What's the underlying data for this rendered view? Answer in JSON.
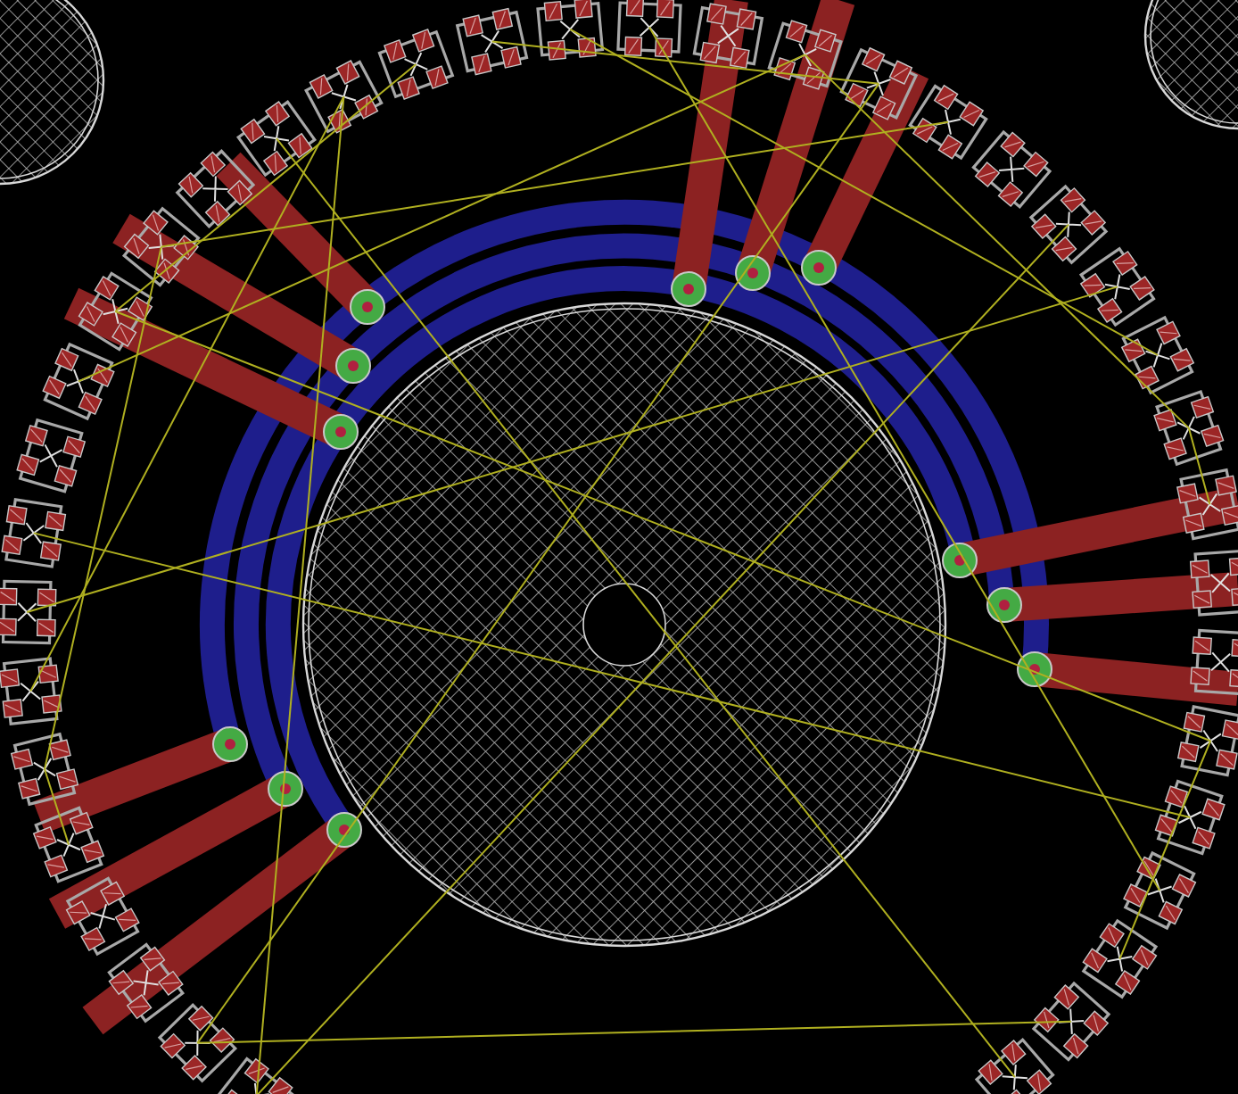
{
  "board": {
    "mounting_holes": [
      {
        "kind": "large"
      },
      {
        "kind": "corner-left"
      },
      {
        "kind": "corner-right"
      }
    ],
    "arc_traces": [
      {
        "color": "#1e1e8c"
      },
      {
        "color": "#1e1e8c"
      },
      {
        "color": "#1e1e8c"
      }
    ],
    "radial_traces": [
      {
        "color": "#8c2222"
      },
      {
        "color": "#8c2222"
      },
      {
        "color": "#8c2222"
      },
      {
        "color": "#8c2222"
      },
      {
        "color": "#8c2222"
      },
      {
        "color": "#8c2222"
      },
      {
        "color": "#8c2222"
      },
      {
        "color": "#8c2222"
      },
      {
        "color": "#8c2222"
      },
      {
        "color": "#8c2222"
      },
      {
        "color": "#8c2222"
      },
      {
        "color": "#8c2222"
      }
    ],
    "vias": [
      {
        "kind": "plated"
      },
      {
        "kind": "plated"
      },
      {
        "kind": "plated"
      },
      {
        "kind": "plated"
      },
      {
        "kind": "plated"
      },
      {
        "kind": "plated"
      },
      {
        "kind": "plated"
      },
      {
        "kind": "plated"
      },
      {
        "kind": "plated"
      },
      {
        "kind": "plated"
      },
      {
        "kind": "plated"
      },
      {
        "kind": "plated"
      }
    ],
    "components": [
      {
        "kind": "smd"
      },
      {
        "kind": "smd"
      },
      {
        "kind": "smd"
      },
      {
        "kind": "smd"
      },
      {
        "kind": "smd"
      },
      {
        "kind": "smd"
      },
      {
        "kind": "smd"
      },
      {
        "kind": "smd"
      },
      {
        "kind": "smd"
      },
      {
        "kind": "smd"
      },
      {
        "kind": "smd"
      },
      {
        "kind": "smd"
      },
      {
        "kind": "smd"
      },
      {
        "kind": "smd"
      },
      {
        "kind": "smd"
      },
      {
        "kind": "smd"
      },
      {
        "kind": "smd"
      },
      {
        "kind": "smd"
      },
      {
        "kind": "smd"
      },
      {
        "kind": "smd"
      },
      {
        "kind": "smd"
      },
      {
        "kind": "smd"
      },
      {
        "kind": "smd"
      },
      {
        "kind": "smd"
      },
      {
        "kind": "smd"
      },
      {
        "kind": "smd"
      },
      {
        "kind": "smd"
      },
      {
        "kind": "smd"
      },
      {
        "kind": "smd"
      },
      {
        "kind": "smd"
      },
      {
        "kind": "smd"
      },
      {
        "kind": "smd"
      },
      {
        "kind": "smd"
      },
      {
        "kind": "smd"
      },
      {
        "kind": "smd"
      },
      {
        "kind": "smd"
      },
      {
        "kind": "smd"
      },
      {
        "kind": "smd"
      }
    ],
    "airwires": [
      {
        "kind": "unrouted"
      },
      {
        "kind": "unrouted"
      },
      {
        "kind": "unrouted"
      },
      {
        "kind": "unrouted"
      },
      {
        "kind": "unrouted"
      },
      {
        "kind": "unrouted"
      },
      {
        "kind": "unrouted"
      },
      {
        "kind": "unrouted"
      },
      {
        "kind": "unrouted"
      },
      {
        "kind": "unrouted"
      },
      {
        "kind": "unrouted"
      },
      {
        "kind": "unrouted"
      },
      {
        "kind": "unrouted"
      },
      {
        "kind": "unrouted"
      },
      {
        "kind": "unrouted"
      },
      {
        "kind": "unrouted"
      },
      {
        "kind": "unrouted"
      },
      {
        "kind": "unrouted"
      },
      {
        "kind": "unrouted"
      },
      {
        "kind": "unrouted"
      }
    ]
  }
}
